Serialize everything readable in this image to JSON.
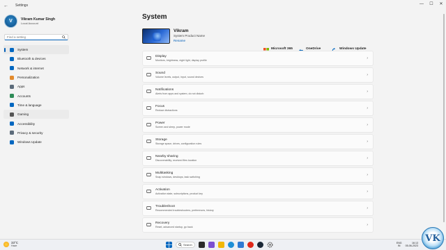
{
  "window": {
    "title": "Settings",
    "back_glyph": "←",
    "min_glyph": "—",
    "max_glyph": "☐",
    "close_glyph": "✕"
  },
  "user": {
    "name": "Vikram Kumar Singh",
    "account_type": "Local Account",
    "avatar_letter": "V"
  },
  "search": {
    "placeholder": "Find a setting"
  },
  "nav": [
    {
      "label": "System",
      "icon": "monitor-icon",
      "color": "#0067c0",
      "active": true
    },
    {
      "label": "Bluetooth & devices",
      "icon": "bluetooth-icon",
      "color": "#0067c0"
    },
    {
      "label": "Network & internet",
      "icon": "wifi-icon",
      "color": "#0067c0"
    },
    {
      "label": "Personalization",
      "icon": "brush-icon",
      "color": "#e38a2b"
    },
    {
      "label": "Apps",
      "icon": "apps-icon",
      "color": "#5c6b7a"
    },
    {
      "label": "Accounts",
      "icon": "person-icon",
      "color": "#2e8b57"
    },
    {
      "label": "Time & language",
      "icon": "globe-clock-icon",
      "color": "#0067c0"
    },
    {
      "label": "Gaming",
      "icon": "gamepad-icon",
      "color": "#555555",
      "hover": true
    },
    {
      "label": "Accessibility",
      "icon": "accessibility-icon",
      "color": "#0067c0"
    },
    {
      "label": "Privacy & security",
      "icon": "shield-icon",
      "color": "#5c6b7a"
    },
    {
      "label": "Windows Update",
      "icon": "refresh-icon",
      "color": "#0067c0"
    }
  ],
  "main": {
    "title": "System",
    "device": {
      "name": "Vikram",
      "model": "System Product Name",
      "rename": "Rename"
    },
    "services": [
      {
        "title": "Microsoft 365",
        "sub": "View benefits",
        "icon": "microsoft-365-icon",
        "link": true
      },
      {
        "title": "OneDrive",
        "sub": "• Sign in",
        "icon": "onedrive-icon",
        "link": true
      },
      {
        "title": "Windows Update",
        "sub": "Last checked: 1 hour ago",
        "icon": "windows-update-icon",
        "link": false
      }
    ],
    "cards": [
      {
        "title": "Display",
        "sub": "Monitors, brightness, night light, display profile",
        "icon": "display-icon"
      },
      {
        "title": "Sound",
        "sub": "Volume levels, output, input, sound devices",
        "icon": "speaker-icon"
      },
      {
        "title": "Notifications",
        "sub": "Alerts from apps and system, do not disturb",
        "icon": "bell-icon"
      },
      {
        "title": "Focus",
        "sub": "Reduce distractions",
        "icon": "focus-icon"
      },
      {
        "title": "Power",
        "sub": "Screen and sleep, power mode",
        "icon": "power-icon"
      },
      {
        "title": "Storage",
        "sub": "Storage space, drives, configuration rules",
        "icon": "storage-icon"
      },
      {
        "title": "Nearby sharing",
        "sub": "Discoverability, received files location",
        "icon": "nearby-sharing-icon"
      },
      {
        "title": "Multitasking",
        "sub": "Snap windows, desktops, task switching",
        "icon": "multitasking-icon"
      },
      {
        "title": "Activation",
        "sub": "Activation state, subscriptions, product key",
        "icon": "activation-icon"
      },
      {
        "title": "Troubleshoot",
        "sub": "Recommended troubleshooters, preferences, history",
        "icon": "wrench-icon"
      },
      {
        "title": "Recovery",
        "sub": "Reset, advanced startup, go back",
        "icon": "recovery-icon"
      }
    ]
  },
  "taskbar": {
    "weather_temp": "33°C",
    "weather_cond": "Haze",
    "search_label": "Search",
    "lang_top": "ENG",
    "lang_bottom": "IN",
    "time": "16:13",
    "date": "05-06-2023"
  },
  "watermark": {
    "text": "VK"
  }
}
